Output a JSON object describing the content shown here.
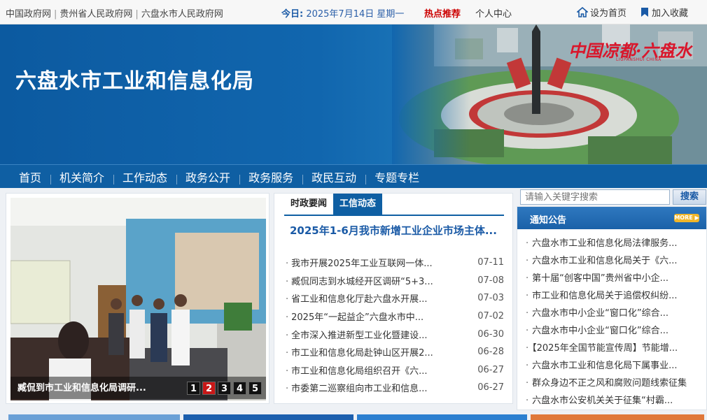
{
  "topbar": {
    "links": [
      "中国政府网",
      "贵州省人民政府网",
      "六盘水市人民政府网"
    ],
    "today_label": "今日:",
    "today_value": "2025年7月14日 星期一",
    "hot": "热点推荐",
    "personal": "个人中心",
    "set_home": "设为首页",
    "add_favorite": "加入收藏"
  },
  "banner": {
    "title": "六盘水市工业和信息化局",
    "logo_text": "中国凉都·六盘水",
    "logo_sub": "LIUPANSHUI CHINA"
  },
  "nav": {
    "items": [
      "首页",
      "机关简介",
      "工作动态",
      "政务公开",
      "政务服务",
      "政民互动",
      "专题专栏"
    ]
  },
  "slideshow": {
    "caption": "臧侃到市工业和信息化局调研...",
    "pages": [
      "1",
      "2",
      "3",
      "4",
      "5"
    ],
    "active_page": 2
  },
  "news": {
    "tabs": [
      "时政要闻",
      "工信动态"
    ],
    "active_tab": "工信动态",
    "headline": "2025年1-6月我市新增工业企业市场主体...",
    "items": [
      {
        "title": "我市开展2025年工业互联网一体...",
        "date": "07-11"
      },
      {
        "title": "臧侃同志到水城经开区调研“5+3...",
        "date": "07-08"
      },
      {
        "title": "省工业和信息化厅赴六盘水开展...",
        "date": "07-03"
      },
      {
        "title": "2025年“一起益企”六盘水市中...",
        "date": "07-02"
      },
      {
        "title": "全市深入推进新型工业化暨建设...",
        "date": "06-30"
      },
      {
        "title": "市工业和信息化局赴钟山区开展2...",
        "date": "06-28"
      },
      {
        "title": "市工业和信息化局组织召开《六...",
        "date": "06-27"
      },
      {
        "title": "市委第二巡察组向市工业和信息...",
        "date": "06-27"
      }
    ]
  },
  "search": {
    "placeholder": "请输入关键字搜索",
    "button": "搜索"
  },
  "notice": {
    "title": "通知公告",
    "more": "MORE ▶",
    "items": [
      "六盘水市工业和信息化局法律服务...",
      "六盘水市工业和信息化局关于《六...",
      "第十届“创客中国”贵州省中小企...",
      "市工业和信息化局关于追偿权纠纷...",
      "六盘水市中小企业“窗口化”综合...",
      "六盘水市中小企业“窗口化”综合...",
      "【2025年全国节能宣传周】节能增...",
      "六盘水市工业和信息化局下属事业...",
      "群众身边不正之风和腐败问题线索征集",
      "六盘水市公安机关关于征集“村霸..."
    ]
  },
  "colors": {
    "primary": "#0f5fa3",
    "hot": "#cc0000",
    "active_page": "#c81818"
  }
}
